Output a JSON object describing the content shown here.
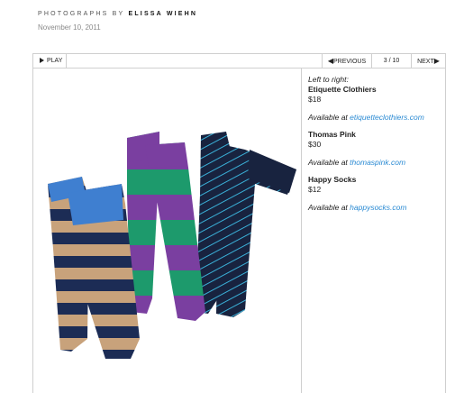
{
  "header": {
    "credit_prefix": "PHOTOGRAPHS BY",
    "credit_name": "ELISSA WIEHN",
    "date": "November 10, 2011"
  },
  "toolbar": {
    "play_label": "PLAY",
    "previous_label": "PREVIOUS",
    "counter": "3 / 10",
    "next_label": "NEXT"
  },
  "caption": {
    "intro": "Left to right:",
    "items": [
      {
        "brand": "Etiquette Clothiers",
        "price": "$18",
        "available_prefix": "Available at",
        "link": "etiquetteclothiers.com"
      },
      {
        "brand": "Thomas Pink",
        "price": "$30",
        "available_prefix": "Available at",
        "link": "thomaspink.com"
      },
      {
        "brand": "Happy Socks",
        "price": "$12",
        "available_prefix": "Available at",
        "link": "happysocks.com"
      }
    ]
  },
  "colors": {
    "link": "#2a8ad3",
    "border": "#cfcfcf",
    "sock1_stripe_a": "#1c2c55",
    "sock1_stripe_b": "#c8a27b",
    "sock1_cuff": "#3f7fd0",
    "sock2_green": "#1d9a6c",
    "sock2_purple": "#7a3fa0",
    "sock3_navy": "#18233f",
    "sock3_pin": "#3ab0d8"
  }
}
